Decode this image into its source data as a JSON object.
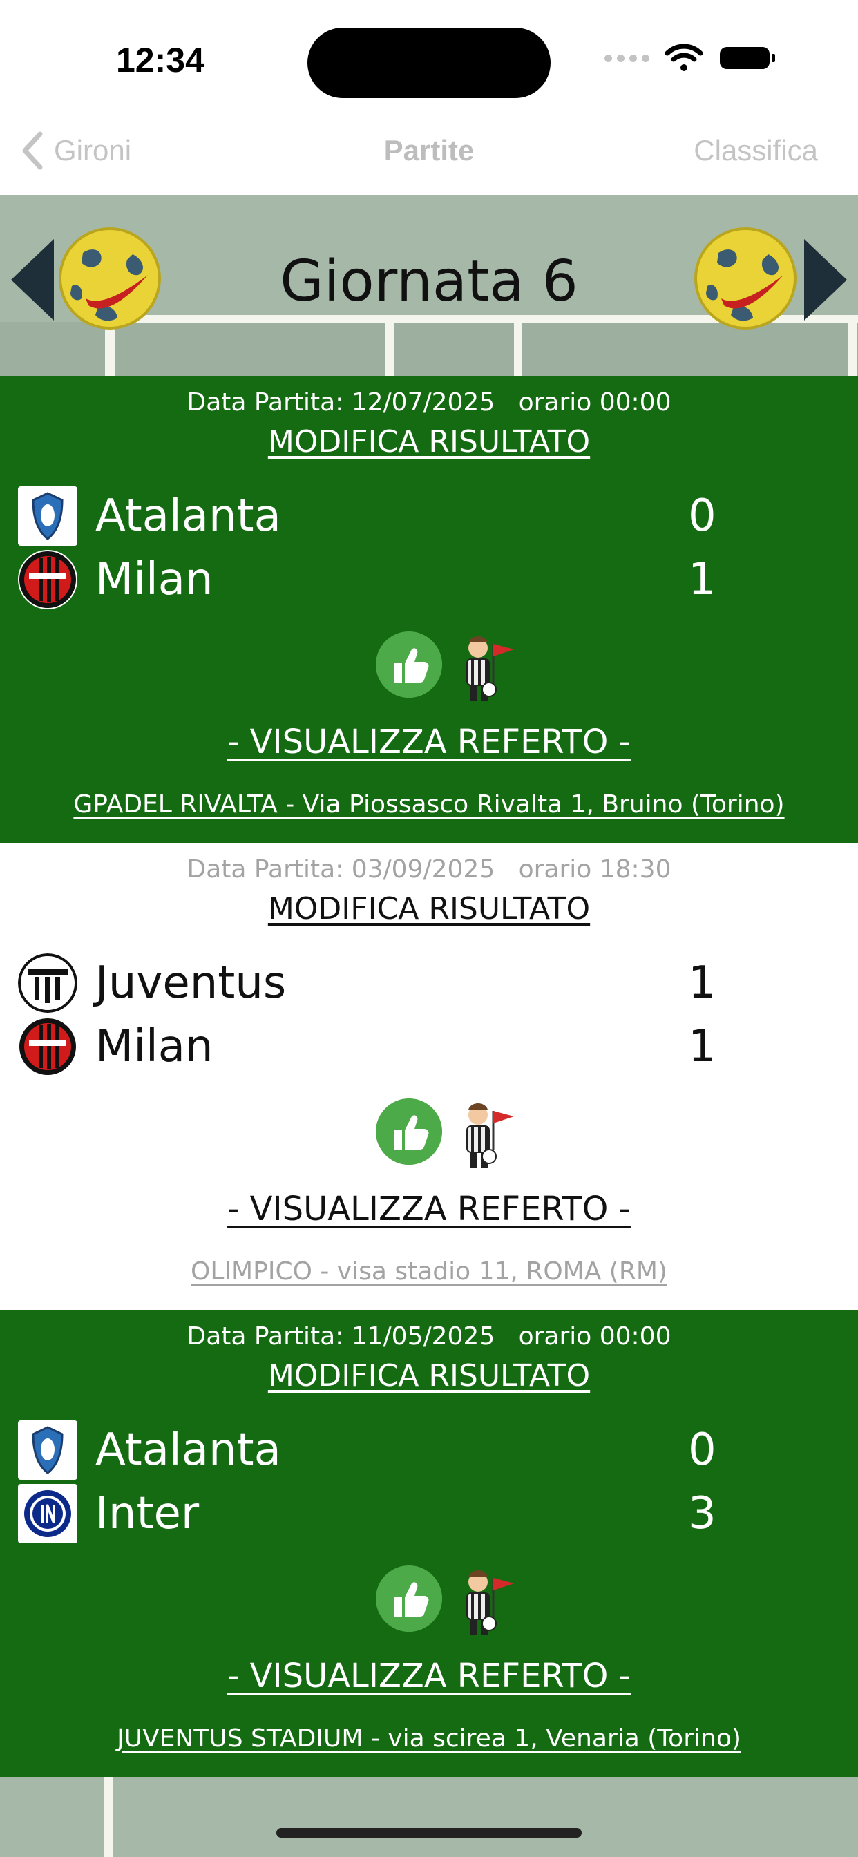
{
  "status_bar": {
    "time": "12:34"
  },
  "nav": {
    "back_label": "Gironi",
    "title": "Partite",
    "right_label": "Classifica"
  },
  "round": {
    "title": "Giornata 6"
  },
  "matches": [
    {
      "date_text": "Data Partita: 12/07/2025",
      "time_text": "orario 00:00",
      "modify_label": "MODIFICA RISULTATO",
      "home": {
        "name": "Atalanta",
        "score": "0"
      },
      "away": {
        "name": "Milan",
        "score": "1"
      },
      "report_label": "- VISUALIZZA REFERTO -",
      "venue": "GPADEL RIVALTA - Via Piossasco Rivalta 1, Bruino (Torino)"
    },
    {
      "date_text": "Data Partita: 03/09/2025",
      "time_text": "orario 18:30",
      "modify_label": "MODIFICA RISULTATO",
      "home": {
        "name": "Juventus",
        "score": "1"
      },
      "away": {
        "name": "Milan",
        "score": "1"
      },
      "report_label": "- VISUALIZZA REFERTO -",
      "venue": "OLIMPICO - visa stadio 11, ROMA (RM)"
    },
    {
      "date_text": "Data Partita: 11/05/2025",
      "time_text": "orario 00:00",
      "modify_label": "MODIFICA RISULTATO",
      "home": {
        "name": "Atalanta",
        "score": "0"
      },
      "away": {
        "name": "Inter",
        "score": "3"
      },
      "report_label": "- VISUALIZZA REFERTO -",
      "venue": "JUVENTUS STADIUM - via scirea  1, Venaria (Torino)"
    }
  ],
  "colors": {
    "card_green": "#146b12",
    "card_white": "#ffffff",
    "pitch": "#a6b8a8",
    "thumb_green": "#4cab48"
  }
}
